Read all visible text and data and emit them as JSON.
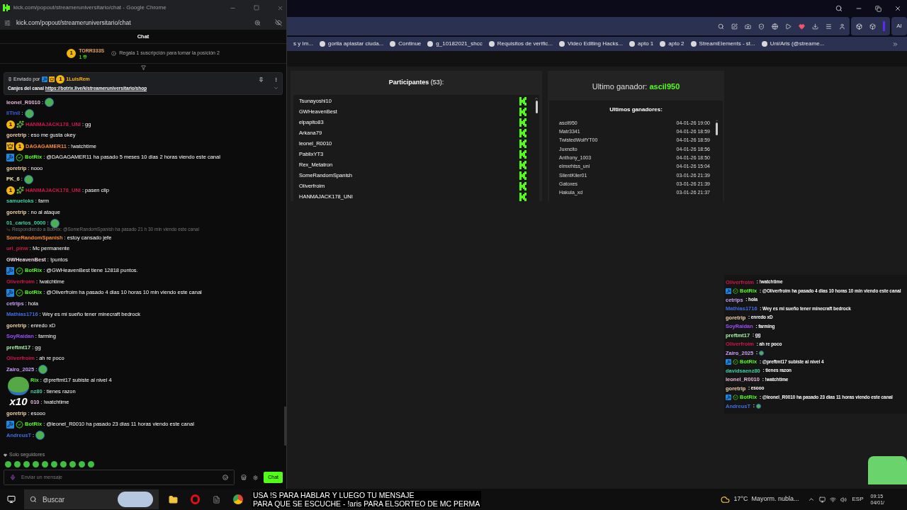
{
  "popup": {
    "title": "kick.com/popout/streameruniversitario/chat - Google Chrome",
    "url": "kick.com/popout/streameruniversitario/chat",
    "chat_title": "Chat",
    "leader": {
      "rank": "1",
      "user": "TORR333S",
      "gifts": "1",
      "hint": "Regala 1 suscripción para tomar la posición 2"
    },
    "pinned": {
      "label": "Enviado por",
      "badges": [
        {
          "kind": "mod"
        },
        {
          "kind": "crown"
        },
        {
          "kind": "sub",
          "text": "1"
        }
      ],
      "user": "1LuisRem",
      "text": "Canjes del canal ",
      "link": "https://botrix.live/k/streameruniversitario/shop"
    },
    "messages": [
      {
        "user": "leonel_R0010",
        "color": "#e8b8d8",
        "text": ":",
        "emote": true
      },
      {
        "user": "IlTinll",
        "color": "#3f5fe0",
        "text": ":",
        "emote": true
      },
      {
        "user": "HANMAJACK178_UNI",
        "color": "#d0154a",
        "badges": [
          {
            "kind": "sub",
            "text": "1"
          },
          {
            "kind": "gift"
          }
        ],
        "text": ": gg"
      },
      {
        "user": "goretrip",
        "color": "#f0d2a8",
        "text": ": eso me gusta okey"
      },
      {
        "user": "DAGAGAMER11",
        "color": "#f5892e",
        "badges": [
          {
            "kind": "crown"
          },
          {
            "kind": "sub",
            "text": "1"
          }
        ],
        "text": ": !watchtime"
      },
      {
        "user": "BotRix",
        "color": "#53fc18",
        "badges": [
          {
            "kind": "mod"
          },
          {
            "kind": "verified"
          }
        ],
        "text": ": @DAGAGAMER11 ha pasado 5 meses 10 dias 2 horas viendo este canal"
      },
      {
        "user": "goretrip",
        "color": "#f0d2a8",
        "text": ": nooo"
      },
      {
        "user": "PK_6",
        "color": "#f5e2b0",
        "text": ":",
        "emote": true
      },
      {
        "user": "HANMAJACK178_UNI",
        "color": "#d0154a",
        "badges": [
          {
            "kind": "sub",
            "text": "1"
          },
          {
            "kind": "gift"
          }
        ],
        "text": ": pasen clip"
      },
      {
        "user": "samueloks",
        "color": "#3fd0a0",
        "text": ": farm"
      },
      {
        "user": "goretrip",
        "color": "#f0d2a8",
        "text": ": no al ataque"
      },
      {
        "user": "01_carlos_0000",
        "color": "#3fd0a0",
        "text": ":",
        "emote": true
      },
      {
        "user": "SomeRandomSpanish",
        "color": "#f5892e",
        "reply": "Respondiendo a BotRix: @SomeRandomSpanish ha pasado 21 h 30 min viendo este canal",
        "text": ": estoy cansado jefe"
      },
      {
        "user": "uri_pinw",
        "color": "#d0154a",
        "text": ": Mc permanente"
      },
      {
        "user": "GWHeavenBest",
        "color": "#f2d6e4",
        "text": ": !puntos"
      },
      {
        "user": "BotRix",
        "color": "#53fc18",
        "badges": [
          {
            "kind": "mod"
          },
          {
            "kind": "verified"
          }
        ],
        "text": ": @GWHeavenBest tiene 12818 puntos."
      },
      {
        "user": "Oliverfroim",
        "color": "#d0154a",
        "text": ": !watchtime"
      },
      {
        "user": "BotRix",
        "color": "#53fc18",
        "badges": [
          {
            "kind": "mod"
          },
          {
            "kind": "verified"
          }
        ],
        "text": ": @Oliverfroim ha pasado 4 dias 10 horas 10 min viendo este canal"
      },
      {
        "user": "cetrips",
        "color": "#c8a0f5",
        "text": ": hola"
      },
      {
        "user": "Mathias1716",
        "color": "#3f6fe0",
        "text": ": Wey es mi sueño tener minecraft bedrock"
      },
      {
        "user": "goretrip",
        "color": "#f0d2a8",
        "text": ": enredo xD"
      },
      {
        "user": "SoyRaidan",
        "color": "#9b4dff",
        "text": ": farming"
      },
      {
        "user": "preftmt17",
        "color": "#a8f0a8",
        "text": ": gg"
      },
      {
        "user": "Oliverfroim",
        "color": "#d0154a",
        "text": ": ah re poco"
      },
      {
        "user": "Zairo_2025",
        "color": "#c8a0f5",
        "text": ":",
        "emote": true
      },
      {
        "user": "Rix",
        "color": "#53fc18",
        "covered": true,
        "text": ": @preftmt17 subiste al nivel 4"
      },
      {
        "user": "nz80",
        "color": "#3fd0a0",
        "covered": true,
        "text": ": tienes razon"
      },
      {
        "user": "010",
        "color": "#e8b8d8",
        "covered": true,
        "text": ": !watchtime"
      },
      {
        "user": "goretrip",
        "color": "#f0d2a8",
        "text": ": esooo"
      },
      {
        "user": "BotRix",
        "color": "#53fc18",
        "badges": [
          {
            "kind": "mod"
          },
          {
            "kind": "verified"
          }
        ],
        "text": ": @leonel_R0010 ha pasado 23 dias 11 horas viendo este canal"
      },
      {
        "user": "AndreusT",
        "color": "#3f6fe0",
        "text": ":",
        "emote": true
      }
    ],
    "overlay_emote": {
      "text": "x10"
    },
    "followers_only": "Solo seguidores",
    "input_placeholder": "Enviar un mensaje",
    "send_button": "Chat"
  },
  "browser": {
    "bookmarks": [
      "s y Im...",
      "gorila aplastar ciuda...",
      "Continue",
      "g_10182021_shcc",
      "Requisitos de verific...",
      "Video Editing Hacks...",
      "apto 1",
      "apto 2",
      "StreamElements - st...",
      "Uni/Aris (@streame..."
    ],
    "ai_label": "AI"
  },
  "participants": {
    "title": "**Participantes** (53):",
    "names": [
      "Tsunayoshi10",
      "GWHeavenBest",
      "elpapito83",
      "Arkana79",
      "leonel_R0010",
      "PablixYT3",
      "Rex_Metatron",
      "SomeRandomSpanish",
      "Oliverfroim",
      "HANMAJACK178_UNI"
    ]
  },
  "winners": {
    "last_label": "Ultimo ganador: ",
    "last_name": "ascil950",
    "list_title": "Ultimos ganadores:",
    "rows": [
      {
        "name": "ascil950",
        "date": "04-01-26 19:00"
      },
      {
        "name": "Matr3341",
        "date": "04-01-26 18:59"
      },
      {
        "name": "TwistedWolfYT00",
        "date": "04-01-26 18:59"
      },
      {
        "name": "Juxncito",
        "date": "04-01-26 18:56"
      },
      {
        "name": "Anthony_1003",
        "date": "04-01-26 18:50"
      },
      {
        "name": "elmxrhtss_uni",
        "date": "04-01-26 15:04"
      },
      {
        "name": "SilentKiler01",
        "date": "03-01-26 21:39"
      },
      {
        "name": "Gatoxes",
        "date": "03-01-26 21:39"
      },
      {
        "name": "Hakula_xd",
        "date": "03-01-26 21:37"
      }
    ]
  },
  "overlay_chat": [
    {
      "user": "Oliverfroim",
      "color": "#d0154a",
      "bot": false,
      "text": " : !watchtime"
    },
    {
      "user": "BotRix",
      "color": "#53fc18",
      "bot": true,
      "text": " : @Oliverfroim ha pasado 4 dias 10 horas 10 min viendo este canal"
    },
    {
      "user": "cetrips",
      "color": "#c8a0f5",
      "bot": false,
      "text": " : hola"
    },
    {
      "user": "Mathias1716",
      "color": "#3f6fe0",
      "bot": false,
      "text": " : Wey es mi sueño tener minecraft bedrock"
    },
    {
      "user": "goretrip",
      "color": "#f0d2a8",
      "bot": false,
      "text": " : enredo xD"
    },
    {
      "user": "SoyRaidan",
      "color": "#9b4dff",
      "bot": false,
      "text": " : farming"
    },
    {
      "user": "preftmt17",
      "color": "#a8f0a8",
      "bot": false,
      "text": " : gg"
    },
    {
      "user": "Oliverfroim",
      "color": "#d0154a",
      "bot": false,
      "text": " : ah re poco"
    },
    {
      "user": "Zairo_2025",
      "color": "#c8a0f5",
      "bot": false,
      "text": " :",
      "emote": true
    },
    {
      "user": "BotRix",
      "color": "#53fc18",
      "bot": true,
      "text": " : @preftmt17 subiste al nivel 4"
    },
    {
      "user": "davidsaenz80",
      "color": "#3fd0a0",
      "bot": false,
      "text": " : tienes razon"
    },
    {
      "user": "leonel_R0010",
      "color": "#e8b8d8",
      "bot": false,
      "text": " : !watchtime"
    },
    {
      "user": "goretrip",
      "color": "#f0d2a8",
      "bot": false,
      "text": " : esooo"
    },
    {
      "user": "BotRix",
      "color": "#53fc18",
      "bot": true,
      "text": " : @leonel_R0010 ha pasado 23 dias 11 horas viendo este canal"
    },
    {
      "user": "AndreusT",
      "color": "#3f6fe0",
      "bot": false,
      "text": " :",
      "emote": true
    }
  ],
  "taskbar": {
    "search": "Buscar",
    "caption": [
      "USA !S PARA HABLAR Y LUEGO TU MENSAJE",
      "PARA QUE SE ESCUCHE - !aris PARA ELSORTEO DE MC PERMA"
    ],
    "weather": "17°C",
    "weather_text": "Mayorm. nubla...",
    "language": "ESP",
    "time": "09:15",
    "date": "04/01/"
  }
}
